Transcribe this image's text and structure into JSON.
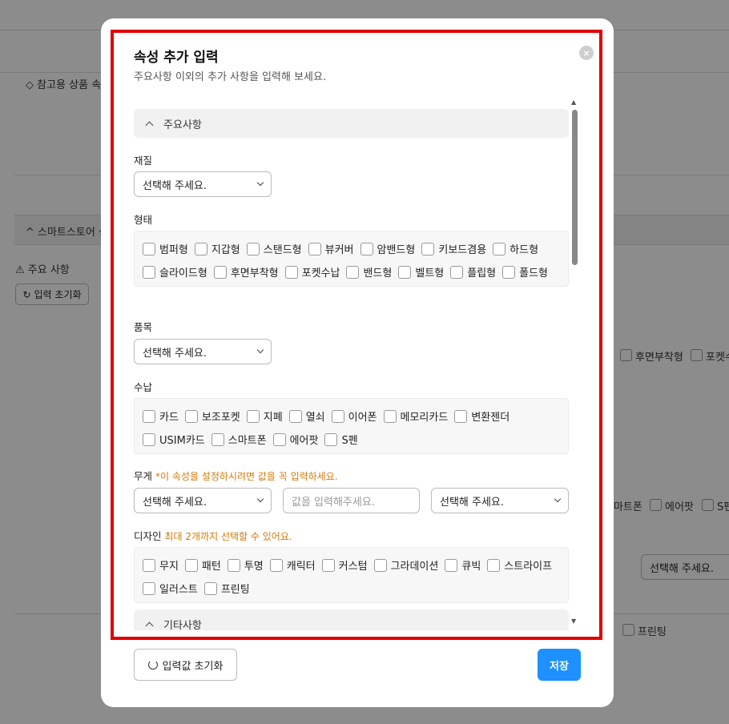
{
  "background": {
    "reference_label": "참고용 상품 속",
    "section_label": "스마트스토어 성",
    "main_label": "주요 사항",
    "reset_label": "입력 초기화",
    "right_checkboxes_row1": [
      "후면부착형",
      "포켓수"
    ],
    "right_checkboxes_row2": [
      "마트폰",
      "에어팟",
      "S펜"
    ],
    "right_select": "선택해 주세요.",
    "right_checkboxes_row3": [
      "프린팅"
    ]
  },
  "modal": {
    "title": "속성 추가 입력",
    "subtitle": "주요사항 이외의 추가 사항을 입력해 보세요.",
    "close_icon": "×",
    "section_main": "주요사항",
    "section_other": "기타사항",
    "material": {
      "label": "재질",
      "value": "선택해 주세요."
    },
    "shape": {
      "label": "형태",
      "rows": [
        [
          "범퍼형",
          "지갑형",
          "스탠드형",
          "뷰커버",
          "암밴드형",
          "키보드겸용",
          "하드형"
        ],
        [
          "슬라이드형",
          "후면부착형",
          "포켓수납",
          "밴드형",
          "벨트형",
          "플립형",
          "폴드형"
        ]
      ]
    },
    "item": {
      "label": "품목",
      "value": "선택해 주세요."
    },
    "storage": {
      "label": "수납",
      "rows": [
        [
          "카드",
          "보조포켓",
          "지폐",
          "열쇠",
          "이어폰",
          "메모리카드",
          "변환젠더"
        ],
        [
          "USIM카드",
          "스마트폰",
          "에어팟",
          "S펜"
        ]
      ]
    },
    "weight": {
      "label": "무게",
      "note": "*이 속성을 설정하시려면 값을 꼭 입력하세요.",
      "select1": "선택해 주세요.",
      "input_placeholder": "값을 입력해주세요.",
      "select2": "선택해 주세요."
    },
    "design": {
      "label": "디자인",
      "note": "최대 2개까지 선택할 수 있어요.",
      "rows": [
        [
          "무지",
          "패턴",
          "투명",
          "캐릭터",
          "커스텀",
          "그라데이션",
          "큐빅",
          "스트라이프"
        ],
        [
          "일러스트",
          "프린팅"
        ]
      ]
    },
    "reset_button": "입력값 초기화",
    "save_button": "저장"
  }
}
